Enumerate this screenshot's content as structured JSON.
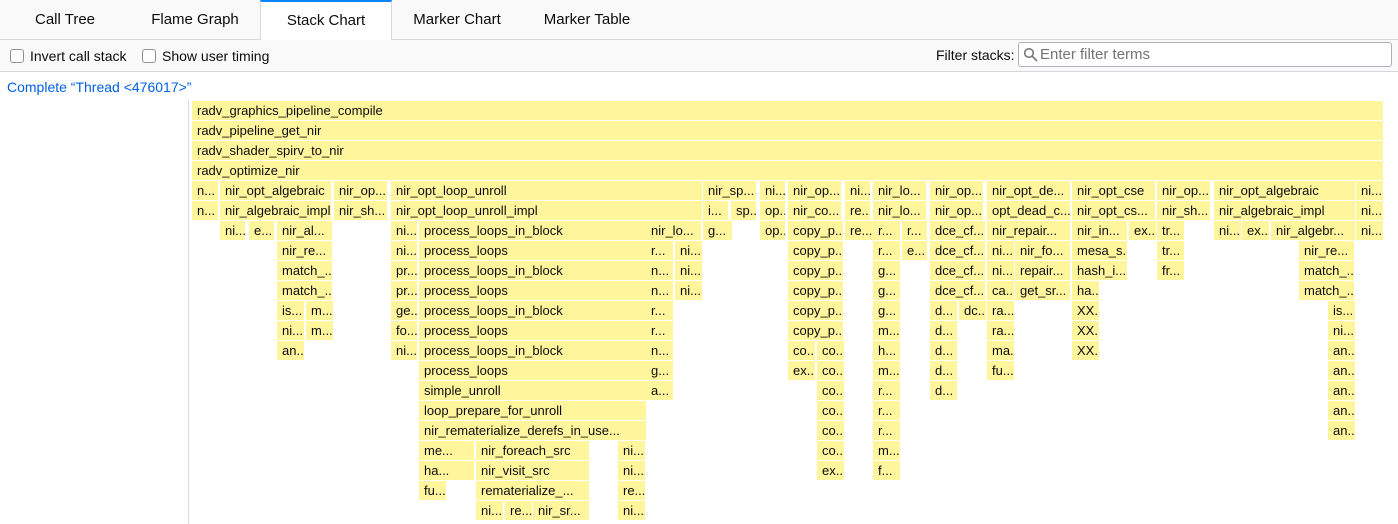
{
  "tabs": [
    {
      "label": "Call Tree",
      "selected": false
    },
    {
      "label": "Flame Graph",
      "selected": false
    },
    {
      "label": "Stack Chart",
      "selected": true
    },
    {
      "label": "Marker Chart",
      "selected": false
    },
    {
      "label": "Marker Table",
      "selected": false
    }
  ],
  "settings": {
    "invert_call_stack": {
      "label": "Invert call stack",
      "checked": false
    },
    "show_user_timing": {
      "label": "Show user timing",
      "checked": false
    },
    "filter_label": "Filter stacks:",
    "filter_placeholder": "Enter filter terms",
    "filter_value": ""
  },
  "breadcrumb": "Complete “Thread <476017>”",
  "colors": {
    "box": "#fff59d",
    "accent": "#0a84ff",
    "link": "#0060df"
  },
  "stack_chart": {
    "rows": [
      [
        "radv_graphics_pipeline_compile"
      ],
      [
        "radv_pipeline_get_nir"
      ],
      [
        "radv_shader_spirv_to_nir"
      ],
      [
        "radv_optimize_nir"
      ],
      [
        "n...",
        "nir_opt_algebraic",
        "nir_op...",
        "nir_opt_loop_unroll",
        "nir_sp...",
        "ni...",
        "nir_op...",
        "ni...",
        "nir_lo...",
        "nir_op...",
        "nir_opt_de...",
        "nir_opt_cse",
        "nir_op...",
        "nir_opt_algebraic",
        "ni..."
      ],
      [
        "n...",
        "nir_algebraic_impl",
        "nir_sh...",
        "nir_opt_loop_unroll_impl",
        "i...",
        "sp...",
        "op...",
        "nir_co...",
        "re...",
        "nir_lo...",
        "nir_op...",
        "opt_dead_c...",
        "nir_opt_cs...",
        "nir_sh...",
        "nir_algebraic_impl",
        "ni..."
      ],
      [
        "ni...",
        "e...",
        "nir_al...",
        "ni...",
        "process_loops_in_block",
        "nir_lo...",
        "g...",
        "op...",
        "copy_p...",
        "re...",
        "r...",
        "r...",
        "dce_cf...",
        "nir_repair...",
        "nir_in...",
        "ex...",
        "tr...",
        "ni...",
        "ex...",
        "nir_algebr...",
        "ni..."
      ],
      [
        "nir_re...",
        "ni...",
        "process_loops",
        "r...",
        "ni...",
        "copy_p...",
        "r...",
        "e...",
        "dce_cf...",
        "ni...",
        "nir_fo...",
        "mesa_s...",
        "tr...",
        "nir_re..."
      ],
      [
        "match_...",
        "pr...",
        "process_loops_in_block",
        "n...",
        "ni...",
        "copy_p...",
        "g...",
        "dce_cf...",
        "ni...",
        "repair...",
        "hash_i...",
        "fr...",
        "match_..."
      ],
      [
        "match_...",
        "pr...",
        "process_loops",
        "n...",
        "ni...",
        "copy_p...",
        "g...",
        "dce_cf...",
        "ca...",
        "get_sr...",
        "ha...",
        "match_..."
      ],
      [
        "is...",
        "m...",
        "ge...",
        "process_loops_in_block",
        "r...",
        "copy_p...",
        "g...",
        "d...",
        "dc...",
        "ra...",
        "XX...",
        "is..."
      ],
      [
        "ni...",
        "m...",
        "fo...",
        "process_loops",
        "r...",
        "copy_p...",
        "m...",
        "d...",
        "ra...",
        "XX...",
        "ni..."
      ],
      [
        "an...",
        "ni...",
        "process_loops_in_block",
        "n...",
        "co...",
        "co...",
        "h...",
        "d...",
        "ma...",
        "XX...",
        "an..."
      ],
      [
        "process_loops",
        "g...",
        "ex...",
        "co...",
        "m...",
        "d...",
        "fu...",
        "an..."
      ],
      [
        "simple_unroll",
        "a...",
        "co...",
        "r...",
        "d...",
        "an..."
      ],
      [
        "loop_prepare_for_unroll",
        "co...",
        "r...",
        "an..."
      ],
      [
        "nir_rematerialize_derefs_in_use...",
        "co...",
        "r...",
        "an..."
      ],
      [
        "me...",
        "nir_foreach_src",
        "ni...",
        "co...",
        "m..."
      ],
      [
        "ha...",
        "nir_visit_src",
        "ni...",
        "ex...",
        "f..."
      ],
      [
        "fu...",
        "rematerialize_...",
        "re..."
      ],
      [
        "ni...",
        "re...",
        "nir_sr...",
        "ni..."
      ]
    ]
  }
}
